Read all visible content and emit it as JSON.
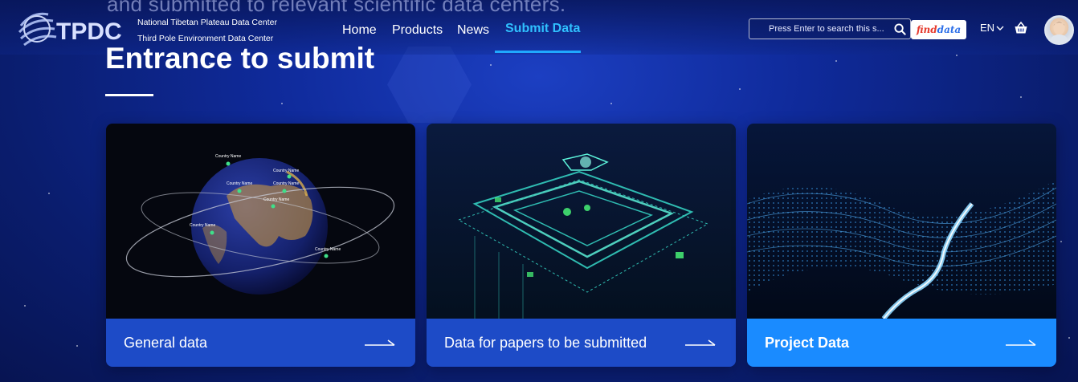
{
  "header": {
    "background_text": "and submitted to relevant scientific data centers.",
    "logo_text": "TPDC",
    "org_name_1": "National Tibetan Plateau Data Center",
    "org_name_2": "Third Pole Environment Data Center",
    "nav": [
      {
        "label": "Home",
        "active": false
      },
      {
        "label": "Products",
        "active": false
      },
      {
        "label": "News",
        "active": false
      },
      {
        "label": "Submit Data",
        "active": true
      }
    ],
    "search_placeholder": "Press Enter to search this s...",
    "finddata_part1": "find",
    "finddata_part2": "data",
    "language": "EN"
  },
  "main": {
    "title": "Entrance to submit",
    "cards": [
      {
        "label": "General data",
        "highlighted": false,
        "icon": "earth-globe-image"
      },
      {
        "label": "Data for papers to be submitted",
        "highlighted": false,
        "icon": "circuit-chip-image"
      },
      {
        "label": "Project Data",
        "highlighted": true,
        "icon": "data-wave-image"
      }
    ],
    "globe_labels": [
      "Country Name",
      "Country Name",
      "Country Name",
      "Country Name",
      "Country Name",
      "Country Name",
      "Country Name"
    ]
  },
  "colors": {
    "background": "#0f2a9a",
    "nav_active": "#2fc0ff",
    "card_footer": "#1d4bc7",
    "card_footer_highlight": "#1a8bff"
  }
}
